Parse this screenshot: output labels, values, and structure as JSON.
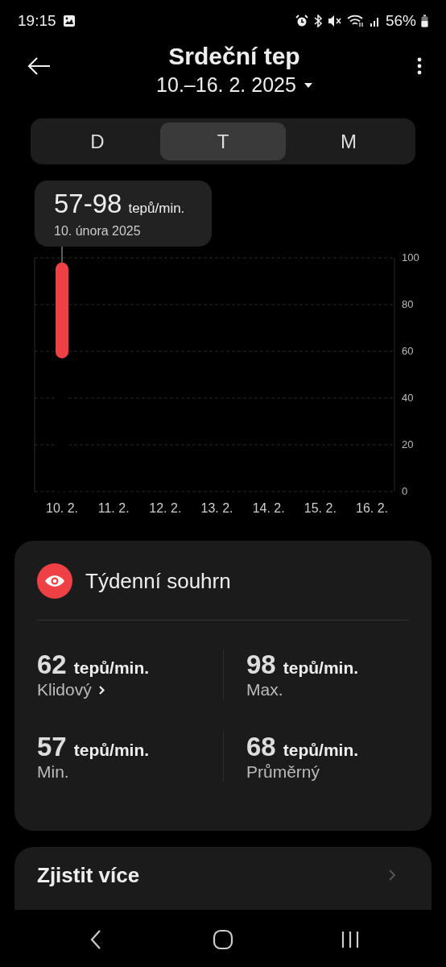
{
  "status_bar": {
    "time": "19:15",
    "battery": "56%"
  },
  "header": {
    "title": "Srdeční tep",
    "date_range": "10.–16. 2. 2025"
  },
  "tabs": [
    {
      "label": "D",
      "selected": false
    },
    {
      "label": "T",
      "selected": true
    },
    {
      "label": "M",
      "selected": false
    }
  ],
  "tooltip": {
    "value": "57-98",
    "unit": "tepů/min.",
    "date": "10. února 2025"
  },
  "chart": {
    "chart_data": {
      "type": "bar",
      "categories": [
        "10. 2.",
        "11. 2.",
        "12. 2.",
        "13. 2.",
        "14. 2.",
        "15. 2.",
        "16. 2."
      ],
      "stacked": true,
      "series": [
        {
          "color": "#000000",
          "values": [
            57,
            null,
            null,
            null,
            null,
            null,
            null
          ]
        },
        {
          "color": "#ef4145",
          "values": [
            41,
            null,
            null,
            null,
            null,
            null,
            null
          ]
        }
      ],
      "ylim": [
        0,
        100
      ],
      "yticks": [
        0,
        20,
        40,
        60,
        80,
        100
      ],
      "grid": true,
      "ref_lines": [
        {
          "axis": "x",
          "value": "10. 2.",
          "color": "#999999"
        }
      ]
    }
  },
  "summary": {
    "title": "Týdenní souhrn",
    "stats": [
      {
        "value": "62",
        "unit": "tepů/min.",
        "label": "Klidový",
        "has_arrow": true
      },
      {
        "value": "98",
        "unit": "tepů/min.",
        "label": "Max.",
        "has_arrow": false
      },
      {
        "value": "57",
        "unit": "tepů/min.",
        "label": "Min.",
        "has_arrow": false
      },
      {
        "value": "68",
        "unit": "tepů/min.",
        "label": "Průměrný",
        "has_arrow": false
      }
    ]
  },
  "learn_more": {
    "label": "Zjistit více"
  }
}
